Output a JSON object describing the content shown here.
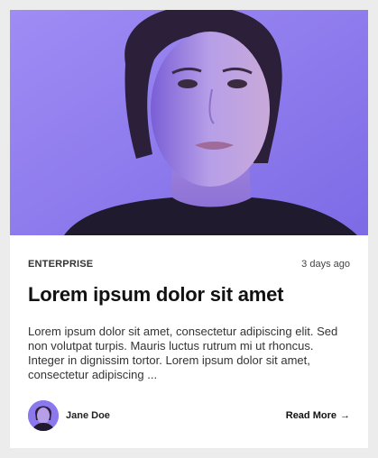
{
  "card": {
    "category": "ENTERPRISE",
    "time_ago": "3 days ago",
    "title": "Lorem ipsum dolor sit amet",
    "excerpt": "Lorem ipsum dolor sit amet, consectetur adipiscing elit. Sed non volutpat turpis. Mauris luctus rutrum mi ut rhoncus. Integer in dignissim tortor. Lorem ipsum dolor sit amet, consectetur adipiscing ...",
    "author": {
      "name": "Jane Doe",
      "avatar_icon": "avatar-photo"
    },
    "read_more_label": "Read More",
    "read_more_icon": "arrow-right-icon"
  },
  "colors": {
    "hero_background": "#8e7bef",
    "card_background": "#ffffff",
    "page_background": "#ececec",
    "title_text": "#111111",
    "body_text": "#333333"
  }
}
